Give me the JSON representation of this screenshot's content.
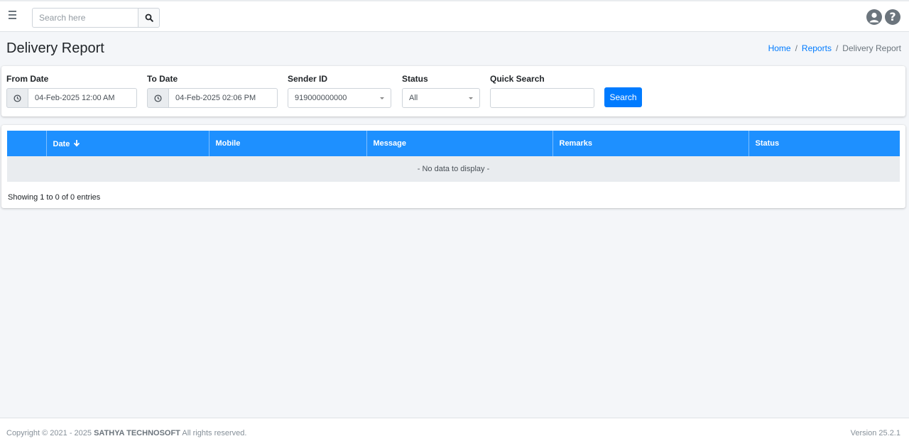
{
  "topbar": {
    "menu_icon": "hamburger-icon",
    "search_placeholder": "Search here",
    "search_value": "",
    "search_icon": "search-icon",
    "user_icon": "user-circle-icon",
    "help_icon": "question-circle-icon",
    "help_glyph": "?"
  },
  "page": {
    "title": "Delivery Report",
    "breadcrumb": [
      "Home",
      "Reports",
      "Delivery Report"
    ],
    "breadcrumb_sep": "/"
  },
  "filters": {
    "from_date": {
      "label": "From Date",
      "value": "04-Feb-2025 12:00 AM",
      "icon": "clock-icon"
    },
    "to_date": {
      "label": "To Date",
      "value": "04-Feb-2025 02:06 PM",
      "icon": "clock-icon"
    },
    "sender_id": {
      "label": "Sender ID",
      "value": "919000000000"
    },
    "status": {
      "label": "Status",
      "value": "All"
    },
    "quick_search": {
      "label": "Quick Search",
      "value": "",
      "placeholder": ""
    },
    "search_button": "Search"
  },
  "table": {
    "columns": [
      "",
      "Date",
      "Mobile",
      "Message",
      "Remarks",
      "Status"
    ],
    "sort_icon": "arrow-down-icon",
    "sorted_column": "Date",
    "rows": [],
    "empty_text": "- No data to display -",
    "info": "Showing 1 to 0 of 0 entries"
  },
  "footer": {
    "copyright_prefix": "Copyright © 2021 - 2025",
    "company": "SATHYA TECHNOSOFT",
    "copyright_suffix": "All rights reserved.",
    "version": "Version 25.2.1"
  },
  "colors": {
    "primary": "#007bff",
    "table_header": "#1e90ff",
    "background": "#f4f6f9"
  }
}
